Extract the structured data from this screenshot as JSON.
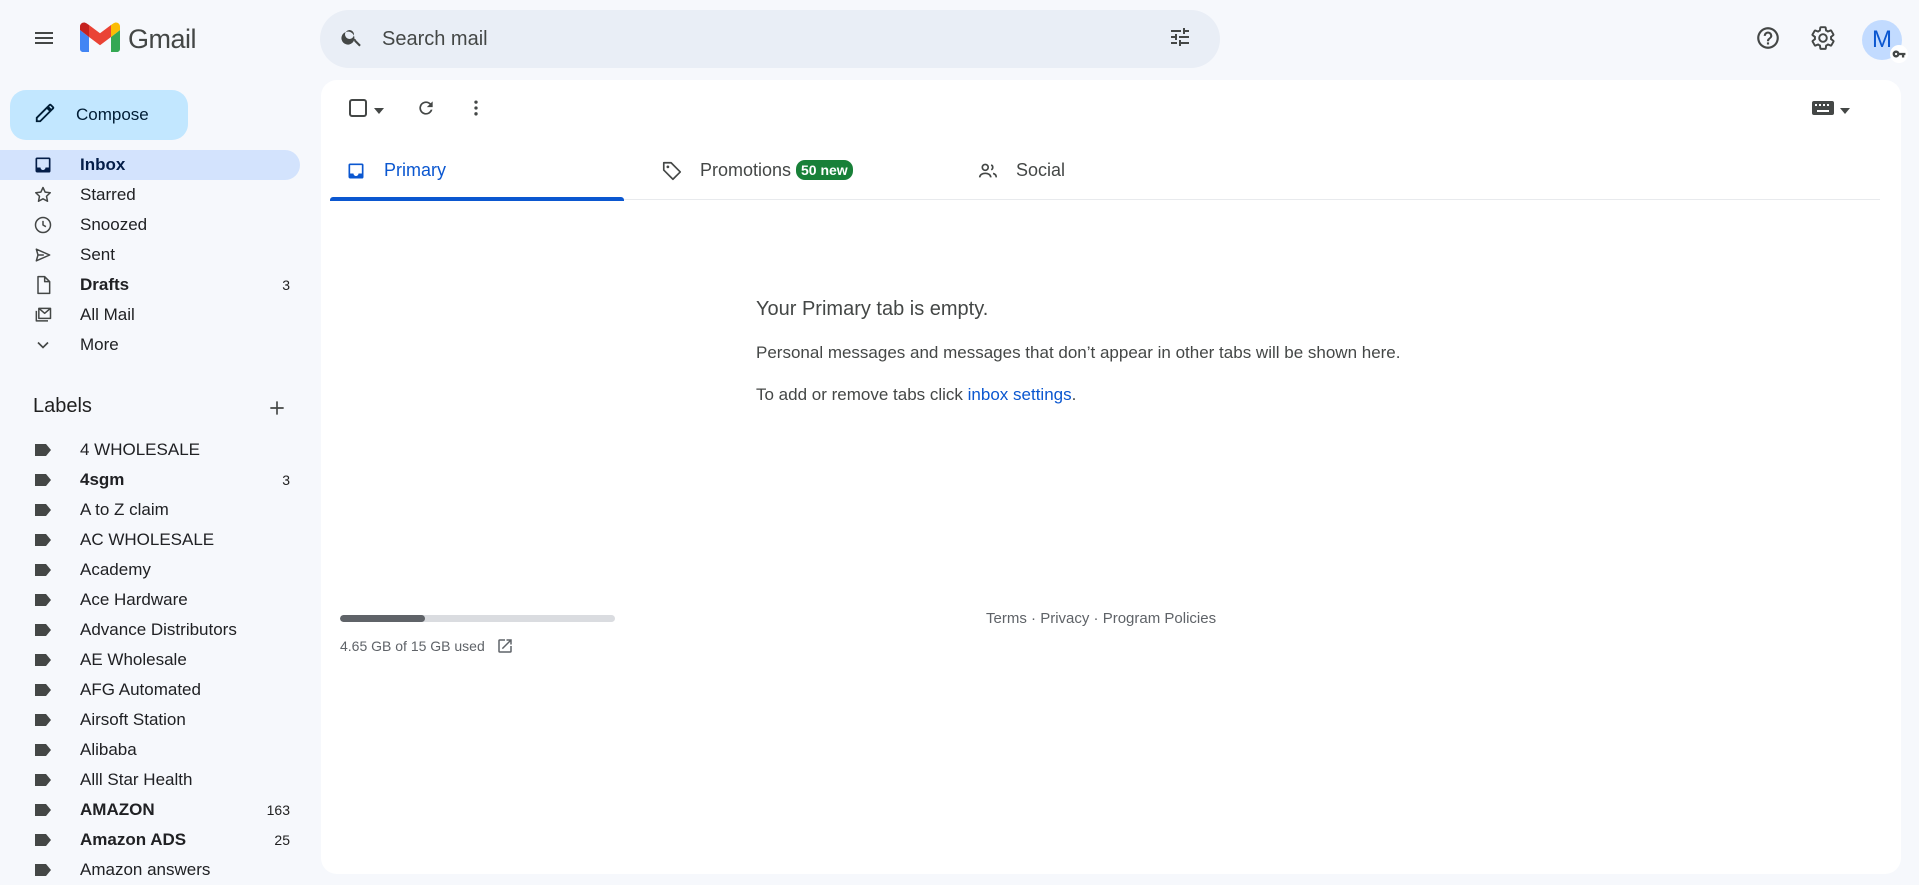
{
  "header": {
    "app_name": "Gmail",
    "search_placeholder": "Search mail",
    "avatar_letter": "M"
  },
  "sidebar": {
    "compose_label": "Compose",
    "nav": [
      {
        "label": "Inbox",
        "count": "",
        "icon": "inbox-icon",
        "active": true,
        "bold": true
      },
      {
        "label": "Starred",
        "count": "",
        "icon": "star-icon",
        "active": false,
        "bold": false
      },
      {
        "label": "Snoozed",
        "count": "",
        "icon": "clock-icon",
        "active": false,
        "bold": false
      },
      {
        "label": "Sent",
        "count": "",
        "icon": "send-icon",
        "active": false,
        "bold": false
      },
      {
        "label": "Drafts",
        "count": "3",
        "icon": "draft-icon",
        "active": false,
        "bold": true
      },
      {
        "label": "All Mail",
        "count": "",
        "icon": "all-mail-icon",
        "active": false,
        "bold": false
      },
      {
        "label": "More",
        "count": "",
        "icon": "chevron-down-icon",
        "active": false,
        "bold": false
      }
    ],
    "labels_title": "Labels",
    "labels": [
      {
        "label": "4 WHOLESALE",
        "count": "",
        "bold": false
      },
      {
        "label": "4sgm",
        "count": "3",
        "bold": true
      },
      {
        "label": "A to Z claim",
        "count": "",
        "bold": false
      },
      {
        "label": "AC WHOLESALE",
        "count": "",
        "bold": false
      },
      {
        "label": "Academy",
        "count": "",
        "bold": false
      },
      {
        "label": "Ace Hardware",
        "count": "",
        "bold": false
      },
      {
        "label": "Advance Distributors",
        "count": "",
        "bold": false
      },
      {
        "label": "AE Wholesale",
        "count": "",
        "bold": false
      },
      {
        "label": "AFG Automated",
        "count": "",
        "bold": false
      },
      {
        "label": "Airsoft Station",
        "count": "",
        "bold": false
      },
      {
        "label": "Alibaba",
        "count": "",
        "bold": false
      },
      {
        "label": "Alll Star Health",
        "count": "",
        "bold": false
      },
      {
        "label": "AMAZON",
        "count": "163",
        "bold": true
      },
      {
        "label": "Amazon ADS",
        "count": "25",
        "bold": true
      },
      {
        "label": "Amazon answers",
        "count": "",
        "bold": false
      }
    ]
  },
  "tabs": [
    {
      "label": "Primary",
      "icon": "inbox-tab-icon",
      "active": true,
      "badge": ""
    },
    {
      "label": "Promotions",
      "icon": "tag-icon",
      "active": false,
      "badge": "50 new"
    },
    {
      "label": "Social",
      "icon": "people-icon",
      "active": false,
      "badge": ""
    }
  ],
  "empty_state": {
    "title": "Your Primary tab is empty.",
    "line1": "Personal messages and messages that don’t appear in other tabs will be shown here.",
    "line2_prefix": "To add or remove tabs click ",
    "line2_link": "inbox settings",
    "line2_suffix": "."
  },
  "storage": {
    "used_text": "4.65 GB of 15 GB used",
    "used_fraction": 0.31
  },
  "footer": {
    "terms": "Terms",
    "privacy": "Privacy",
    "program_policies": "Program Policies",
    "separator": " · "
  },
  "colors": {
    "accent": "#0b57d0",
    "compose_bg": "#c2e7ff",
    "active_nav_bg": "#d3e3fd",
    "badge_bg": "#188038",
    "page_bg": "#f6f8fc"
  }
}
